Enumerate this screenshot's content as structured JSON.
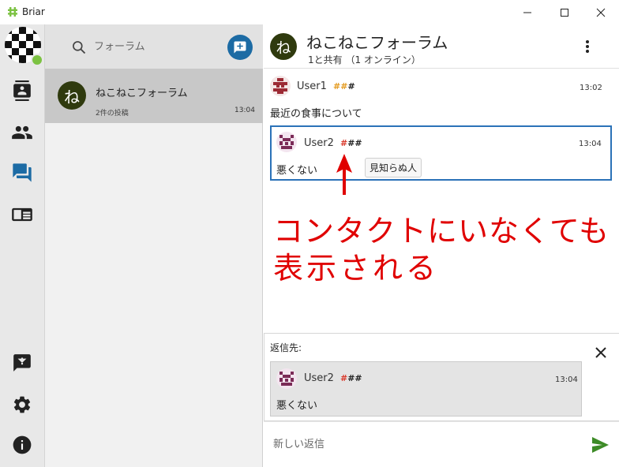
{
  "window": {
    "title": "Briar"
  },
  "search": {
    "placeholder": "フォーラム"
  },
  "forum_list": [
    {
      "avatar_letter": "ね",
      "name": "ねこねこフォーラム",
      "posts": "2件の投稿",
      "time": "13:04"
    }
  ],
  "header": {
    "avatar_letter": "ね",
    "title": "ねこねこフォーラム",
    "subtitle": "1と共有 （1 オンライン）"
  },
  "posts": [
    {
      "author": "User1",
      "hash_parts": [
        "##",
        "#"
      ],
      "time": "13:02",
      "text": "最近の食事について"
    }
  ],
  "reply": {
    "author": "User2",
    "hash_parts": [
      "#",
      "##"
    ],
    "time": "13:04",
    "text": "悪くない",
    "tooltip": "見知らぬ人"
  },
  "annotation": {
    "line1": "コンタクトにいなくても",
    "line2": "表示される",
    "color": "#e00000"
  },
  "reply_panel": {
    "label": "返信先:",
    "author": "User2",
    "hash_parts": [
      "#",
      "##"
    ],
    "time": "13:04",
    "text": "悪くない"
  },
  "composer": {
    "placeholder": "新しい返信"
  },
  "colors": {
    "accent": "#1c6ba4",
    "forum_avatar": "#2f3a0e",
    "online": "#7cc242",
    "send": "#3d8b27",
    "highlight_border": "#2b72b8"
  },
  "icons": {
    "rail": [
      "contacts-icon",
      "groups-icon",
      "forums-icon",
      "blogs-icon",
      "feedback-icon",
      "settings-icon",
      "info-icon"
    ]
  }
}
